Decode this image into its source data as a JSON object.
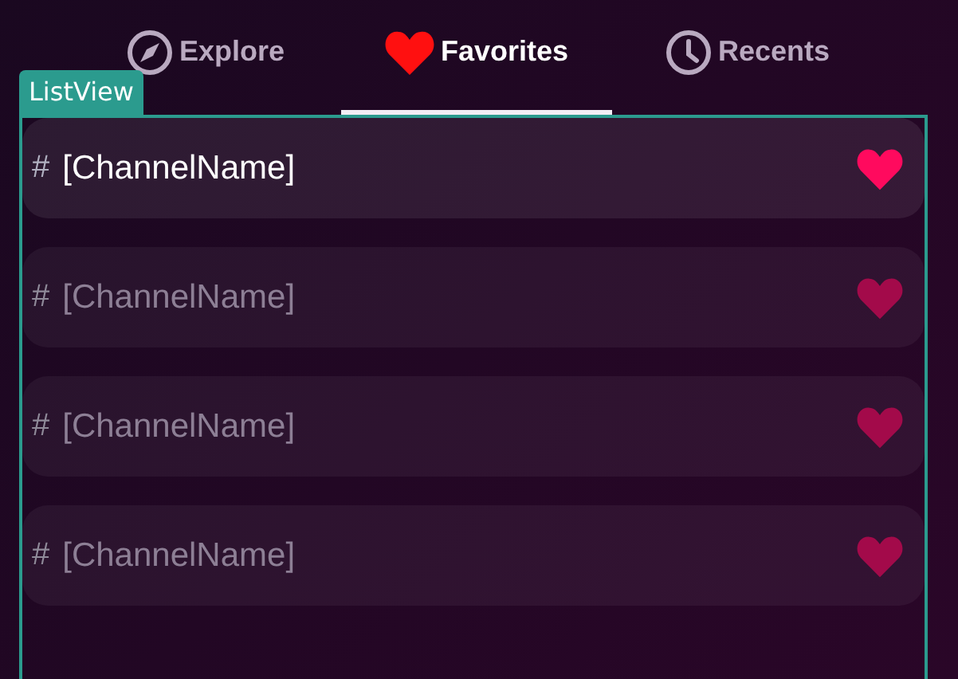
{
  "tabs": [
    {
      "label": "Explore",
      "kind": "compass",
      "selected": false
    },
    {
      "label": "Favorites",
      "kind": "heart",
      "selected": true
    },
    {
      "label": "Recents",
      "kind": "clock",
      "selected": false
    }
  ],
  "list_view": {
    "label": "ListView",
    "rows": [
      {
        "hash": "#",
        "name": "[ChannelName]",
        "selected": true
      },
      {
        "hash": "#",
        "name": "[ChannelName]",
        "selected": false
      },
      {
        "hash": "#",
        "name": "[ChannelName]",
        "selected": false
      },
      {
        "hash": "#",
        "name": "[ChannelName]",
        "selected": false
      }
    ]
  }
}
